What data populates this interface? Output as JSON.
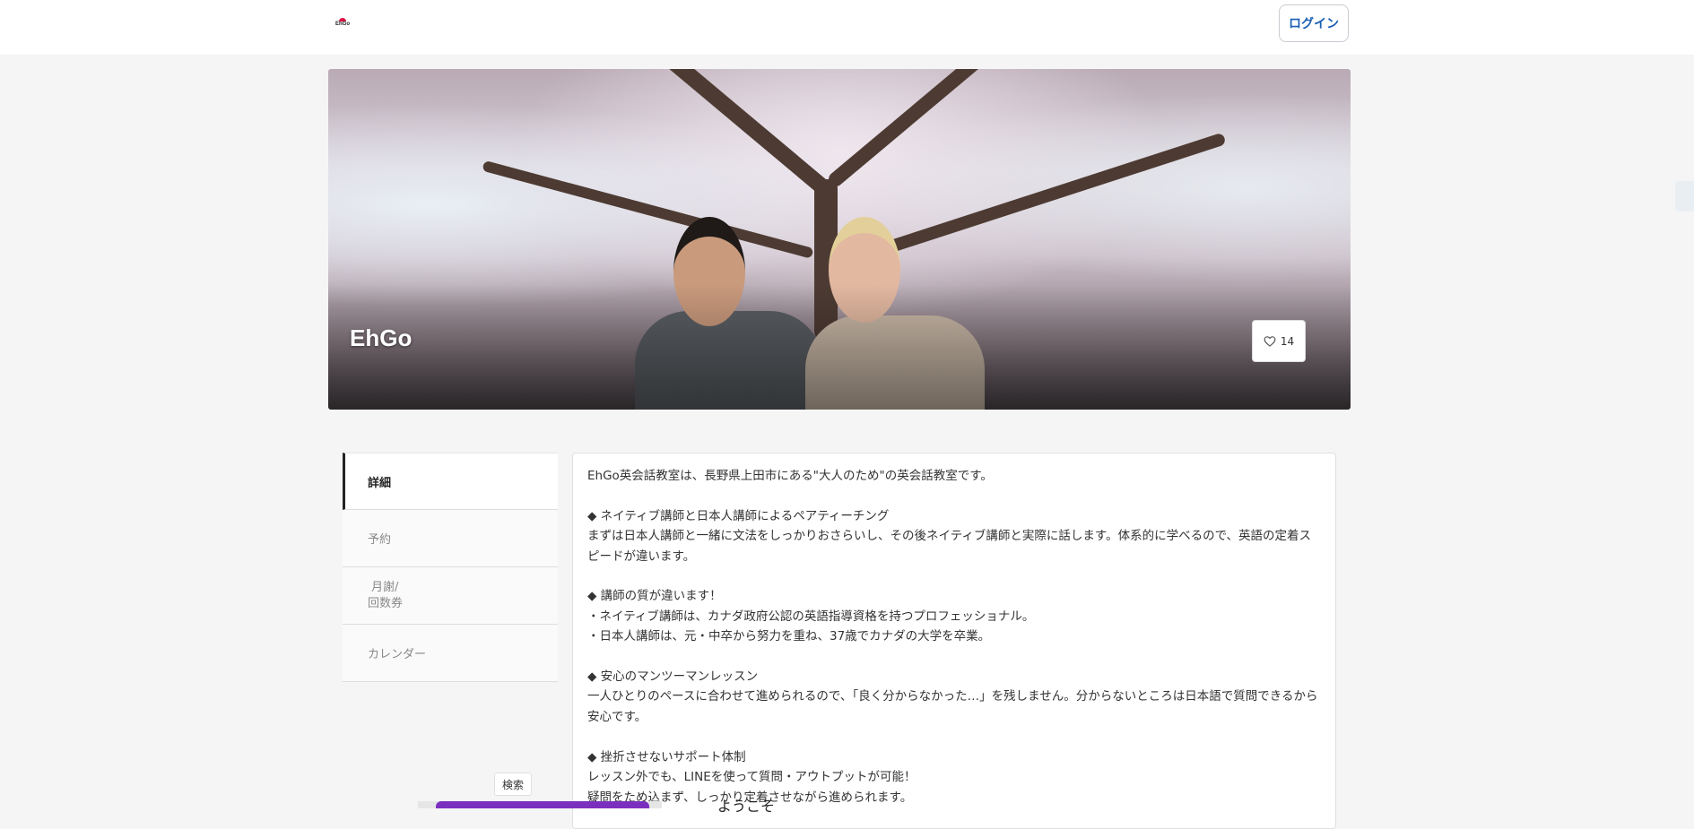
{
  "header": {
    "logo_text": "EhGo",
    "login_label": "ログイン"
  },
  "hero": {
    "title": "EhGo",
    "like_count": "14"
  },
  "sidebar": {
    "items": [
      {
        "label": "詳細"
      },
      {
        "label": "予約"
      },
      {
        "label_line1": "月謝/",
        "label_line2": "回数券"
      },
      {
        "label": "カレンダー"
      }
    ]
  },
  "description": {
    "lines": [
      "EhGo英会話教室は、長野県上田市にある\"大人のため\"の英会話教室です。",
      "",
      "◆ ネイティブ講師と日本人講師によるペアティーチング",
      "まずは日本人講師と一緒に文法をしっかりおさらいし、その後ネイティブ講師と実際に話します。体系的に学べるので、英語の定着スピードが違います。",
      "",
      "◆ 講師の質が違います！",
      "・ネイティブ講師は、カナダ政府公認の英語指導資格を持つプロフェッショナル。",
      "・日本人講師は、元・中卒から努力を重ね、37歳でカナダの大学を卒業。",
      "",
      "◆ 安心のマンツーマンレッスン",
      "一人ひとりのペースに合わせて進められるので、「良く分からなかった…」を残しません。分からないところは日本語で質問できるから安心です。",
      "",
      "◆ 挫折させないサポート体制",
      "レッスン外でも、LINEを使って質問・アウトプットが可能！",
      "疑問をため込まず、しっかり定着させながら進められます。"
    ]
  },
  "overlay": {
    "search_tooltip": "検索",
    "bottom_text": "ようこそ"
  },
  "icons": {
    "like": "heart-outline-icon"
  }
}
